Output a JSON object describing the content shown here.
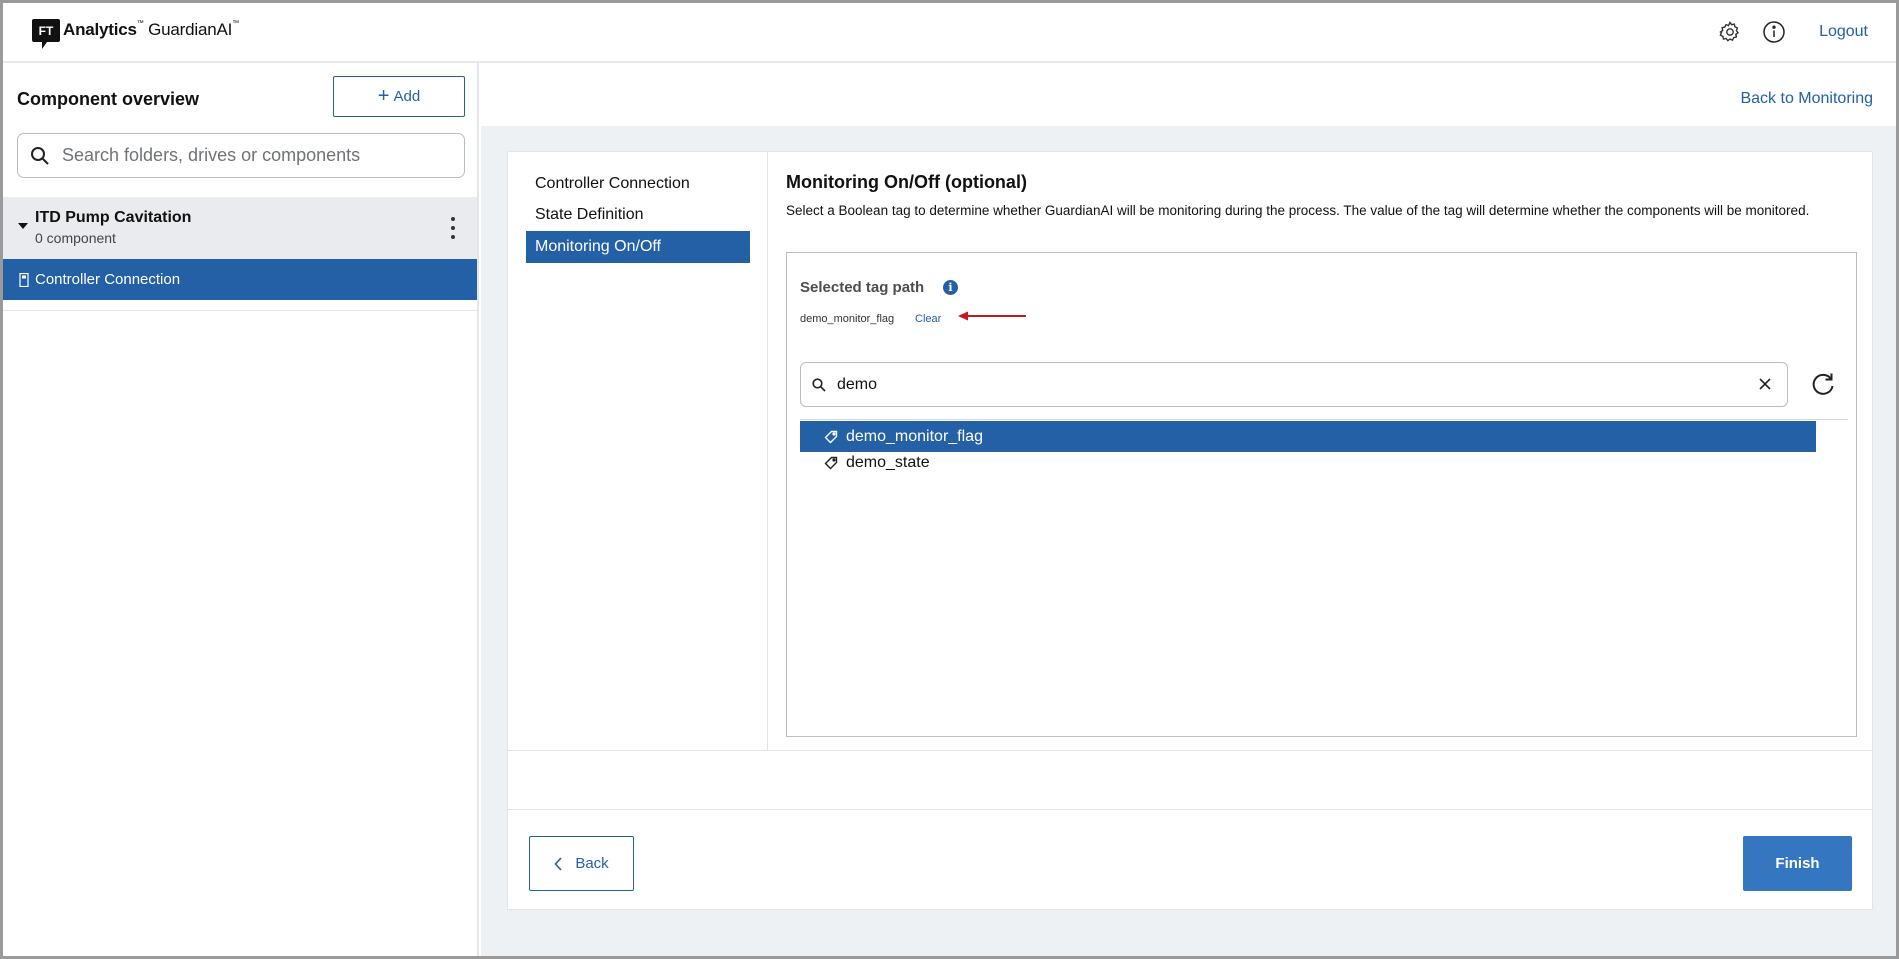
{
  "app": {
    "logo_mark": "FT",
    "logo_bold": "Analytics",
    "logo_product": "GuardianAI",
    "tm": "™"
  },
  "topbar": {
    "settings_icon": "gear-icon",
    "info_icon": "info-circle-icon",
    "logout_label": "Logout"
  },
  "sidebar": {
    "title": "Component overview",
    "add_label": "Add",
    "search_placeholder": "Search folders, drives or components",
    "folder": {
      "name": "ITD Pump Cavitation",
      "count": "0 component"
    },
    "active_item": "Controller Connection"
  },
  "main": {
    "back_to_monitoring": "Back to Monitoring",
    "steps": [
      {
        "label": "Controller Connection",
        "active": false
      },
      {
        "label": "State Definition",
        "active": false
      },
      {
        "label": "Monitoring On/Off",
        "active": true
      }
    ],
    "title": "Monitoring On/Off (optional)",
    "description": "Select a Boolean tag to determine whether GuardianAI will be monitoring during the process. The value of the tag will determine whether the components will be monitored.",
    "selected_tag_label": "Selected tag path",
    "info_glyph": "i",
    "selected_tag_value": "demo_monitor_flag",
    "clear_label": "Clear",
    "tag_search_value": "demo",
    "tags": [
      {
        "label": "demo_monitor_flag",
        "selected": true
      },
      {
        "label": "demo_state",
        "selected": false
      }
    ],
    "back_label": "Back",
    "finish_label": "Finish"
  },
  "colors": {
    "accent": "#2360a5",
    "link": "#2260a8",
    "finish": "#3477c0",
    "annotation_arrow": "#c8141b"
  }
}
